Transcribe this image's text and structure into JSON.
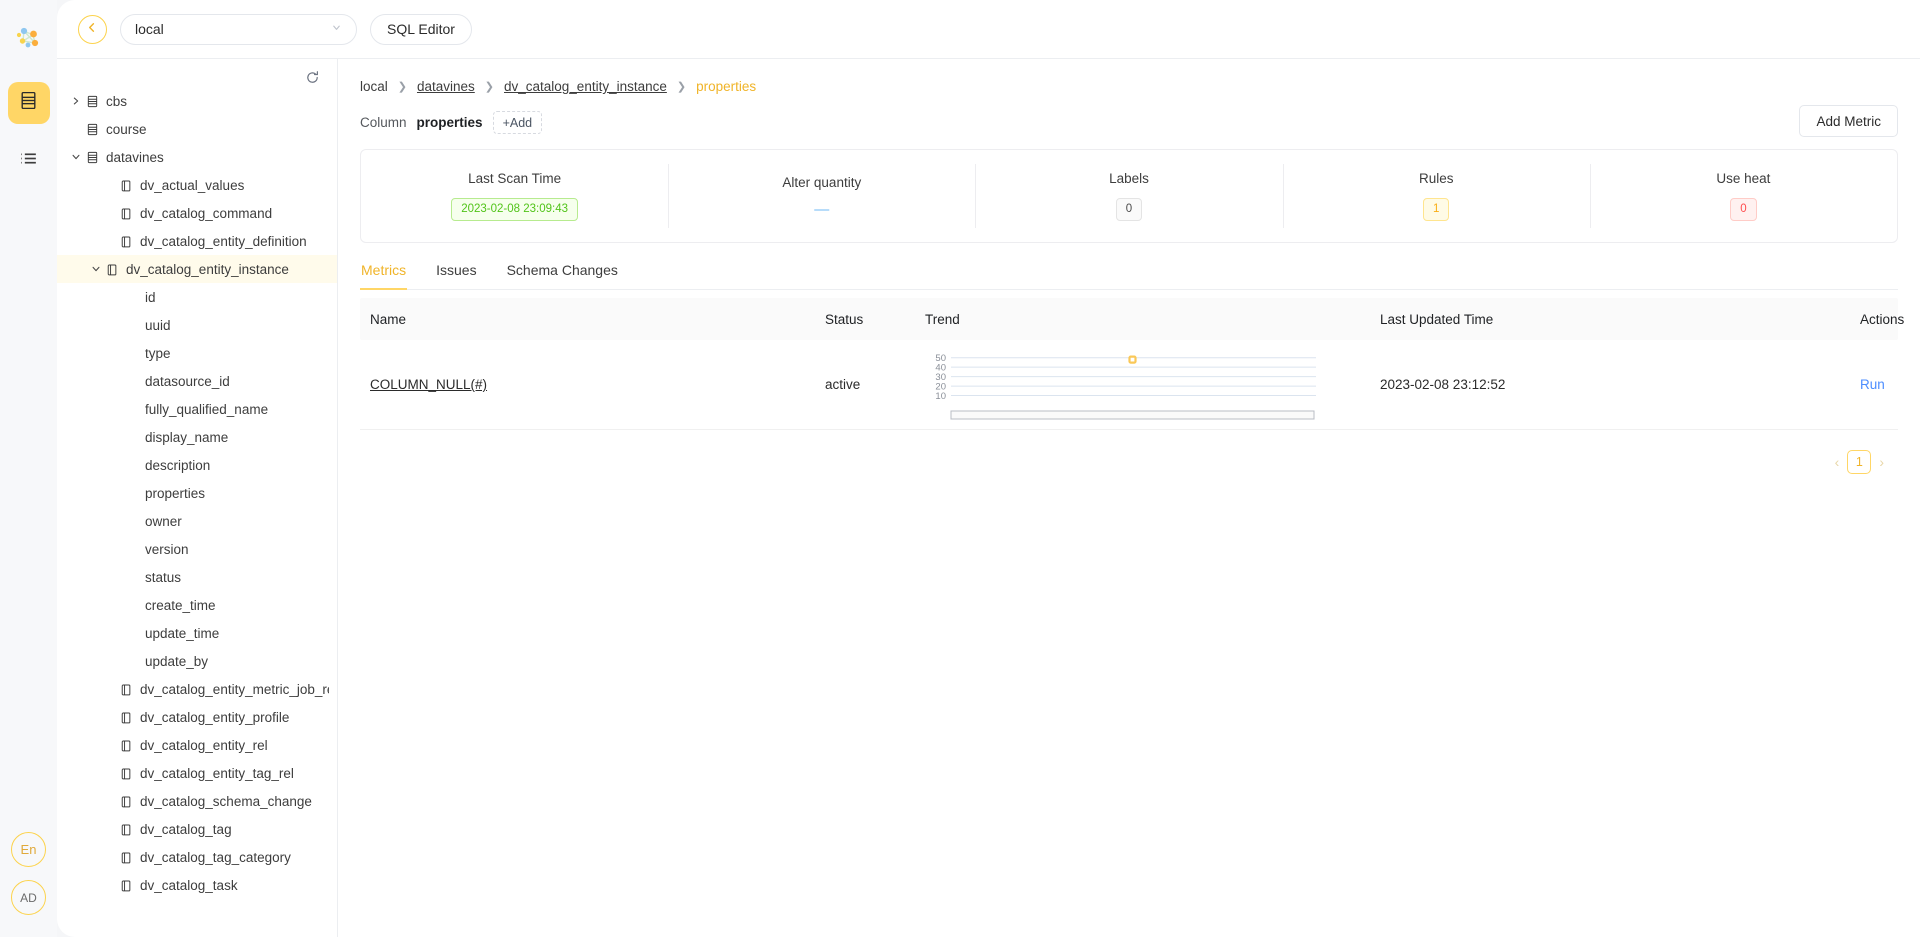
{
  "rail": {
    "logo_icon": "network-graph-logo",
    "items": [
      {
        "icon": "database-icon",
        "name": "catalog",
        "active": true
      },
      {
        "icon": "list-icon",
        "name": "tasks",
        "active": false
      }
    ],
    "lang_button": "En",
    "avatar_button": "AD"
  },
  "topbar": {
    "back_icon": "arrow-left-icon",
    "datasource_value": "local",
    "datasource_caret": "chevron-down-icon",
    "sql_editor_label": "SQL Editor"
  },
  "tree": {
    "refresh_icon": "refresh-icon",
    "nodes": [
      {
        "label": "cbs",
        "level": 0,
        "icon": "database-icon",
        "arrow": "collapsed",
        "selected": false
      },
      {
        "label": "course",
        "level": 0,
        "icon": "database-icon",
        "arrow": "none",
        "selected": false
      },
      {
        "label": "datavines",
        "level": 0,
        "icon": "database-icon",
        "arrow": "expanded",
        "selected": false
      },
      {
        "label": "dv_actual_values",
        "level": 1,
        "icon": "table-icon",
        "arrow": "none",
        "selected": false
      },
      {
        "label": "dv_catalog_command",
        "level": 1,
        "icon": "table-icon",
        "arrow": "none",
        "selected": false
      },
      {
        "label": "dv_catalog_entity_definition",
        "level": 1,
        "icon": "table-icon",
        "arrow": "none",
        "selected": false
      },
      {
        "label": "dv_catalog_entity_instance",
        "level": 1,
        "icon": "table-icon",
        "arrow": "expanded",
        "selected": true
      },
      {
        "label": "id",
        "level": 2,
        "icon": "none",
        "arrow": "none",
        "selected": false
      },
      {
        "label": "uuid",
        "level": 2,
        "icon": "none",
        "arrow": "none",
        "selected": false
      },
      {
        "label": "type",
        "level": 2,
        "icon": "none",
        "arrow": "none",
        "selected": false
      },
      {
        "label": "datasource_id",
        "level": 2,
        "icon": "none",
        "arrow": "none",
        "selected": false
      },
      {
        "label": "fully_qualified_name",
        "level": 2,
        "icon": "none",
        "arrow": "none",
        "selected": false
      },
      {
        "label": "display_name",
        "level": 2,
        "icon": "none",
        "arrow": "none",
        "selected": false
      },
      {
        "label": "description",
        "level": 2,
        "icon": "none",
        "arrow": "none",
        "selected": false
      },
      {
        "label": "properties",
        "level": 2,
        "icon": "none",
        "arrow": "none",
        "selected": false
      },
      {
        "label": "owner",
        "level": 2,
        "icon": "none",
        "arrow": "none",
        "selected": false
      },
      {
        "label": "version",
        "level": 2,
        "icon": "none",
        "arrow": "none",
        "selected": false
      },
      {
        "label": "status",
        "level": 2,
        "icon": "none",
        "arrow": "none",
        "selected": false
      },
      {
        "label": "create_time",
        "level": 2,
        "icon": "none",
        "arrow": "none",
        "selected": false
      },
      {
        "label": "update_time",
        "level": 2,
        "icon": "none",
        "arrow": "none",
        "selected": false
      },
      {
        "label": "update_by",
        "level": 2,
        "icon": "none",
        "arrow": "none",
        "selected": false
      },
      {
        "label": "dv_catalog_entity_metric_job_rel",
        "level": 1,
        "icon": "table-icon",
        "arrow": "none",
        "selected": false
      },
      {
        "label": "dv_catalog_entity_profile",
        "level": 1,
        "icon": "table-icon",
        "arrow": "none",
        "selected": false
      },
      {
        "label": "dv_catalog_entity_rel",
        "level": 1,
        "icon": "table-icon",
        "arrow": "none",
        "selected": false
      },
      {
        "label": "dv_catalog_entity_tag_rel",
        "level": 1,
        "icon": "table-icon",
        "arrow": "none",
        "selected": false
      },
      {
        "label": "dv_catalog_schema_change",
        "level": 1,
        "icon": "table-icon",
        "arrow": "none",
        "selected": false
      },
      {
        "label": "dv_catalog_tag",
        "level": 1,
        "icon": "table-icon",
        "arrow": "none",
        "selected": false
      },
      {
        "label": "dv_catalog_tag_category",
        "level": 1,
        "icon": "table-icon",
        "arrow": "none",
        "selected": false
      },
      {
        "label": "dv_catalog_task",
        "level": 1,
        "icon": "table-icon",
        "arrow": "none",
        "selected": false
      }
    ]
  },
  "breadcrumb": [
    {
      "text": "local",
      "link": false,
      "current": false
    },
    {
      "text": "datavines",
      "link": true,
      "current": false
    },
    {
      "text": "dv_catalog_entity_instance",
      "link": true,
      "current": false
    },
    {
      "text": "properties",
      "link": false,
      "current": true
    }
  ],
  "column_row": {
    "label": "Column",
    "value": "properties",
    "add_label": "+Add",
    "add_metric_label": "Add Metric"
  },
  "stats": [
    {
      "title": "Last Scan Time",
      "value": "2023-02-08 23:09:43",
      "style": "green"
    },
    {
      "title": "Alter quantity",
      "value": "—",
      "style": "dash"
    },
    {
      "title": "Labels",
      "value": "0",
      "style": "grey"
    },
    {
      "title": "Rules",
      "value": "1",
      "style": "gold"
    },
    {
      "title": "Use heat",
      "value": "0",
      "style": "red"
    }
  ],
  "tabs": [
    {
      "label": "Metrics",
      "active": true
    },
    {
      "label": "Issues",
      "active": false
    },
    {
      "label": "Schema Changes",
      "active": false
    }
  ],
  "table": {
    "headers": [
      "Name",
      "Status",
      "Trend",
      "Last Updated Time",
      "Actions"
    ],
    "rows": [
      {
        "name": "COLUMN_NULL(#)",
        "status": "active",
        "last_updated": "2023-02-08 23:12:52",
        "action": "Run"
      }
    ]
  },
  "chart_data": {
    "type": "line",
    "title": "",
    "xlabel": "",
    "ylabel": "",
    "ylim": [
      0,
      55
    ],
    "yticks": [
      50,
      40,
      30,
      20,
      10
    ],
    "grid": true,
    "legend": "none",
    "point_color": "#fac858",
    "series": [
      {
        "name": "COLUMN_NULL(#)",
        "x": [
          0.5
        ],
        "values": [
          48
        ]
      }
    ]
  },
  "pagination": {
    "prev_icon": "chevron-left-icon",
    "next_icon": "chevron-right-icon",
    "current_page": "1"
  },
  "colors": {
    "accent": "#ffd666",
    "accent_text": "#f0b429",
    "link": "#4c8dff",
    "green": "#52c41a",
    "red": "#ff4d4f"
  }
}
